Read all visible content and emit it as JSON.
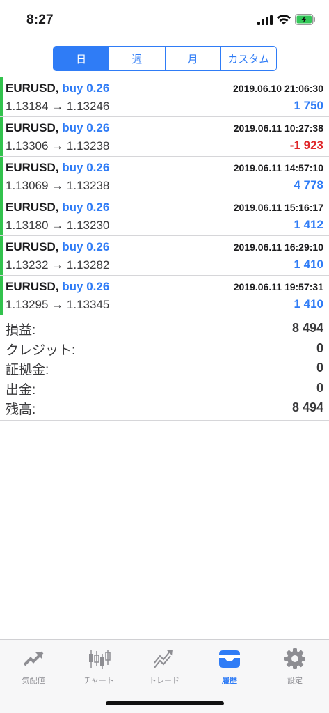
{
  "status_bar": {
    "time": "8:27"
  },
  "segments": [
    {
      "label": "日",
      "active": true
    },
    {
      "label": "週",
      "active": false
    },
    {
      "label": "月",
      "active": false
    },
    {
      "label": "カスタム",
      "active": false
    }
  ],
  "deals": [
    {
      "symbol": "EURUSD,",
      "side": "buy 0.26",
      "time": "2019.06.10 21:06:30",
      "prices": "1.13184 → 1.13246",
      "profit": "1 750"
    },
    {
      "symbol": "EURUSD,",
      "side": "buy 0.26",
      "time": "2019.06.11 10:27:38",
      "prices": "1.13306 → 1.13238",
      "profit": "-1 923"
    },
    {
      "symbol": "EURUSD,",
      "side": "buy 0.26",
      "time": "2019.06.11 14:57:10",
      "prices": "1.13069 → 1.13238",
      "profit": "4 778"
    },
    {
      "symbol": "EURUSD,",
      "side": "buy 0.26",
      "time": "2019.06.11 15:16:17",
      "prices": "1.13180 → 1.13230",
      "profit": "1 412"
    },
    {
      "symbol": "EURUSD,",
      "side": "buy 0.26",
      "time": "2019.06.11 16:29:10",
      "prices": "1.13232 → 1.13282",
      "profit": "1 410"
    },
    {
      "symbol": "EURUSD,",
      "side": "buy 0.26",
      "time": "2019.06.11 19:57:31",
      "prices": "1.13295 → 1.13345",
      "profit": "1 410"
    }
  ],
  "summary": [
    {
      "label": "損益:",
      "value": "8 494"
    },
    {
      "label": "クレジット:",
      "value": "0"
    },
    {
      "label": "証拠金:",
      "value": "0"
    },
    {
      "label": "出金:",
      "value": "0"
    },
    {
      "label": "残高:",
      "value": "8 494"
    }
  ],
  "tabs": [
    {
      "label": "気配値",
      "icon": "quotes-icon",
      "active": false
    },
    {
      "label": "チャート",
      "icon": "chart-icon",
      "active": false
    },
    {
      "label": "トレード",
      "icon": "trade-icon",
      "active": false
    },
    {
      "label": "履歴",
      "icon": "history-icon",
      "active": true
    },
    {
      "label": "設定",
      "icon": "settings-icon",
      "active": false
    }
  ],
  "colors": {
    "accent": "#2f7cf6",
    "negative": "#e0262a",
    "buy_bar": "#32c24d"
  }
}
